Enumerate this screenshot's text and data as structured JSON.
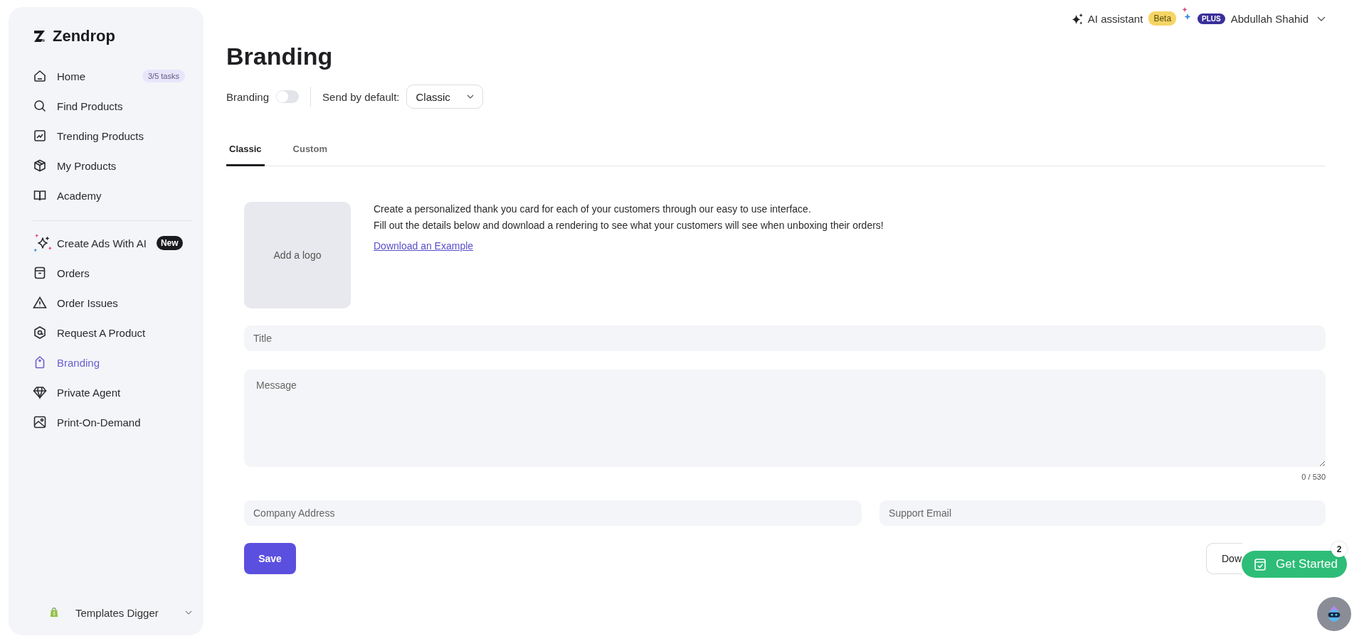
{
  "sidebar": {
    "logo": "Zendrop",
    "items": [
      {
        "label": "Home",
        "selected": false,
        "badge": {
          "text": "3/5 tasks",
          "kind": "count"
        }
      },
      {
        "label": "Find Products",
        "selected": false
      },
      {
        "label": "Trending Products",
        "selected": false
      },
      {
        "label": "My Products",
        "selected": false
      },
      {
        "label": "Academy",
        "selected": false
      }
    ],
    "items_2": [
      {
        "label": "Create Ads With AI",
        "selected": false,
        "badge": {
          "text": "New",
          "kind": "new"
        }
      },
      {
        "label": "Orders",
        "selected": false
      },
      {
        "label": "Order Issues",
        "selected": false
      },
      {
        "label": "Request A Product",
        "selected": false
      },
      {
        "label": "Branding",
        "selected": true
      },
      {
        "label": "Private Agent",
        "selected": false
      },
      {
        "label": "Print-On-Demand",
        "selected": false
      }
    ],
    "store": "Templates Digger"
  },
  "top_bar": {
    "assistant": "AI assistant",
    "assistant_badge": "Beta",
    "plan": "PLUS",
    "user": "Abdullah Shahid"
  },
  "page": {
    "title": "Branding",
    "branding_toggle": {
      "label": "Branding",
      "on": false
    },
    "send_default": {
      "label": "Send by default:",
      "value": "Classic"
    },
    "tabs": [
      {
        "label": "Classic",
        "selected": true
      },
      {
        "label": "Custom",
        "selected": false
      }
    ],
    "logo_placeholder": "Add a logo",
    "intro": [
      "Create a personalized thank you card for each of your customers through our easy to use interface.",
      "Fill out the details below and download a rendering to see what your customers will see when unboxing their orders!"
    ],
    "example_link": "Download an Example",
    "title_field": {
      "placeholder": "Title"
    },
    "message_field": {
      "placeholder": "Message"
    },
    "char_count": "0 / 530",
    "address_field": {
      "placeholder": "Company Address"
    },
    "email_field": {
      "placeholder": "Support Email"
    },
    "save": "Save",
    "download": "Dow"
  },
  "get_started": {
    "label": "Get Started",
    "count": "2"
  }
}
